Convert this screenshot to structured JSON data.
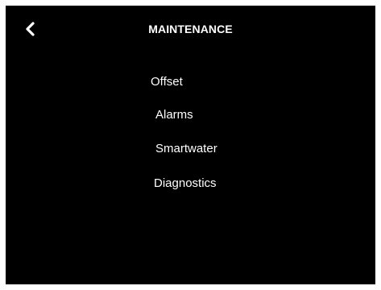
{
  "header": {
    "title": "MAINTENANCE",
    "back_icon": "chevron-left-icon"
  },
  "menu": {
    "items": [
      {
        "label": "Offset"
      },
      {
        "label": "Alarms"
      },
      {
        "label": "Smartwater"
      },
      {
        "label": "Diagnostics"
      }
    ]
  },
  "colors": {
    "background": "#000000",
    "text": "#ffffff",
    "frame": "#ffffff"
  }
}
